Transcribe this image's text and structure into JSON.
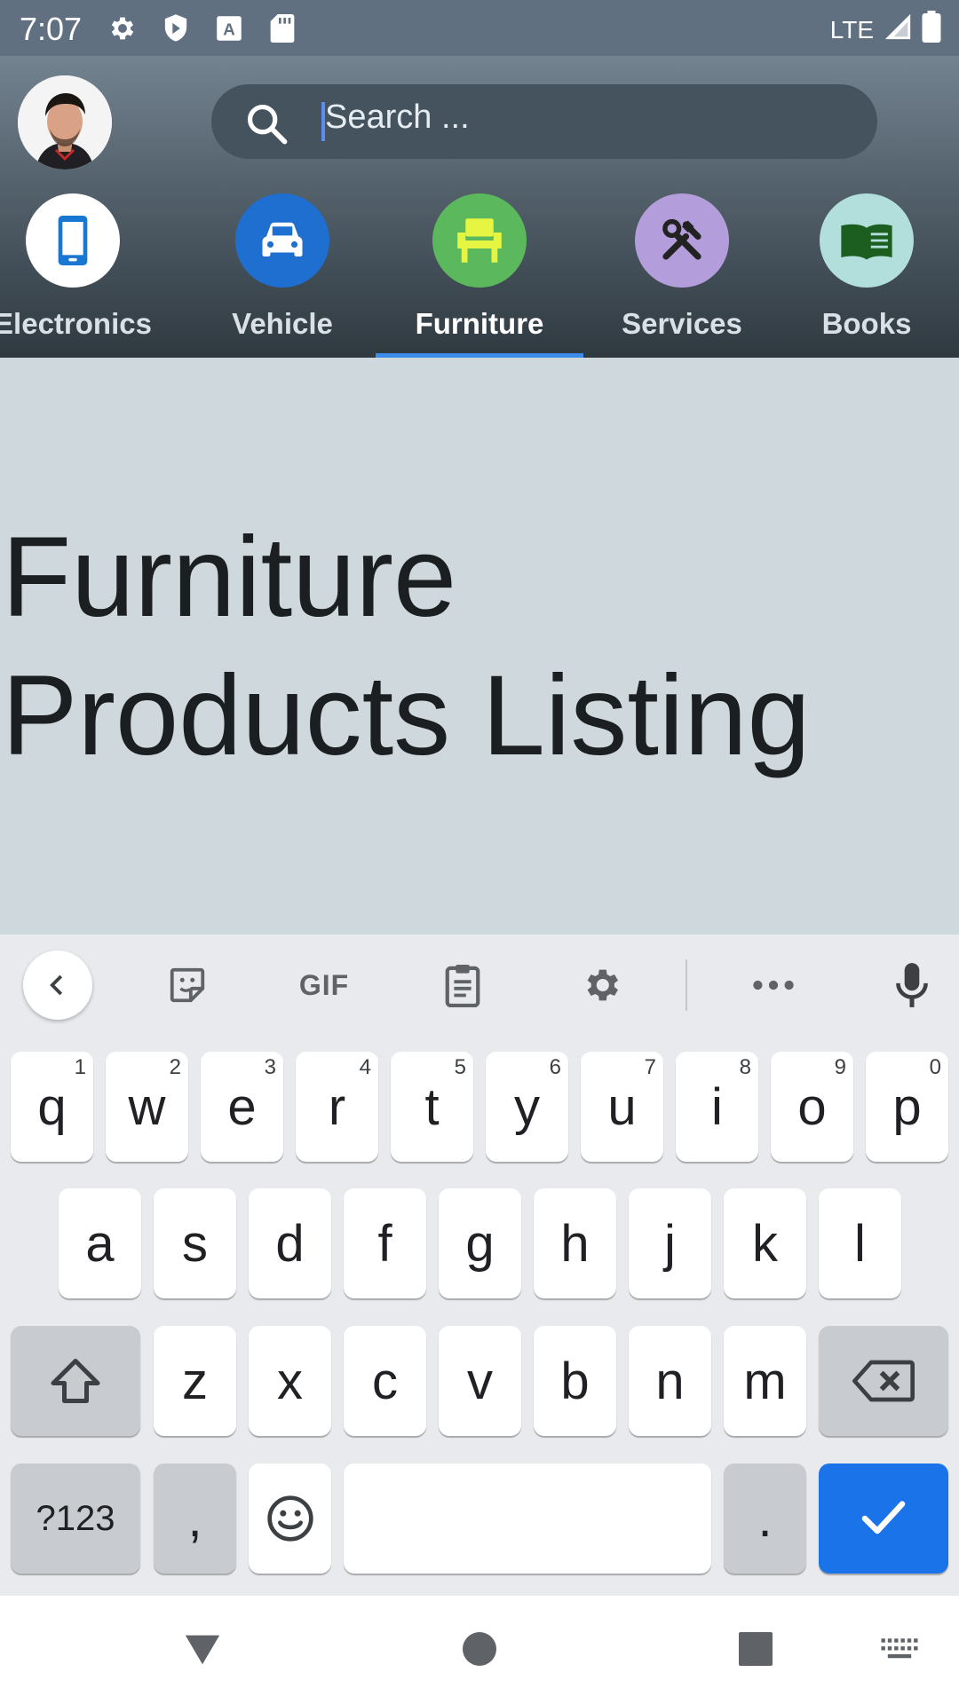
{
  "status_bar": {
    "time": "7:07",
    "network": "LTE"
  },
  "header": {
    "search_placeholder": "Search ...",
    "categories": [
      {
        "label": "Electronics",
        "color": "#ffffff",
        "icon": "smartphone-icon",
        "icon_color": "#1976d2"
      },
      {
        "label": "Vehicle",
        "color": "#1e6fd0",
        "icon": "car-icon",
        "icon_color": "#ffffff"
      },
      {
        "label": "Furniture",
        "color": "#5cb85c",
        "icon": "chair-icon",
        "icon_color": "#e6f542",
        "active": true
      },
      {
        "label": "Services",
        "color": "#b39ddb",
        "icon": "tools-icon",
        "icon_color": "#222222"
      },
      {
        "label": "Books",
        "color": "#b2dfdb",
        "icon": "book-icon",
        "icon_color": "#1b5e20"
      }
    ]
  },
  "content": {
    "title_line1": "Furniture",
    "title_line2": "Products Listing"
  },
  "keyboard": {
    "toolbar": {
      "gif_label": "GIF"
    },
    "row1": [
      {
        "k": "q",
        "h": "1"
      },
      {
        "k": "w",
        "h": "2"
      },
      {
        "k": "e",
        "h": "3"
      },
      {
        "k": "r",
        "h": "4"
      },
      {
        "k": "t",
        "h": "5"
      },
      {
        "k": "y",
        "h": "6"
      },
      {
        "k": "u",
        "h": "7"
      },
      {
        "k": "i",
        "h": "8"
      },
      {
        "k": "o",
        "h": "9"
      },
      {
        "k": "p",
        "h": "0"
      }
    ],
    "row2": [
      "a",
      "s",
      "d",
      "f",
      "g",
      "h",
      "j",
      "k",
      "l"
    ],
    "row3": [
      "z",
      "x",
      "c",
      "v",
      "b",
      "n",
      "m"
    ],
    "symbols_label": "?123",
    "comma_label": ",",
    "period_label": "."
  }
}
